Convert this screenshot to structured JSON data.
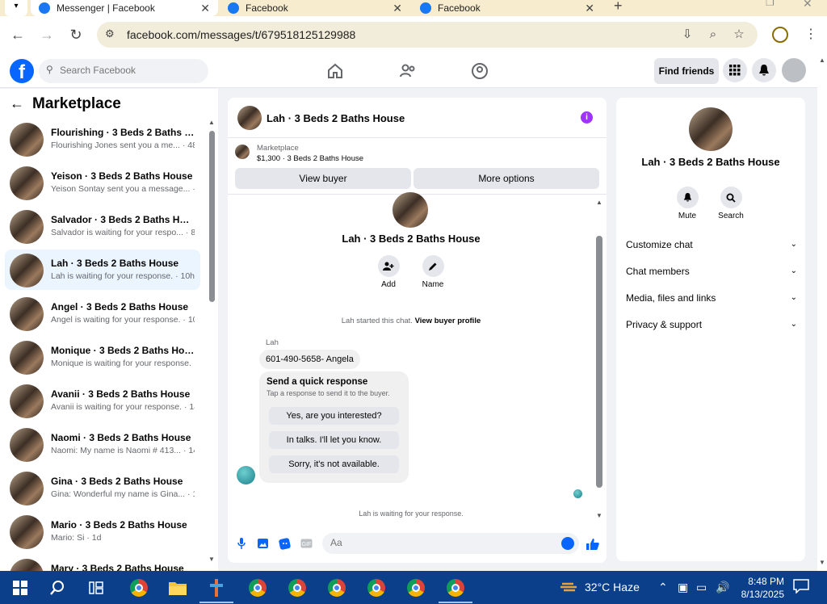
{
  "browser": {
    "tabs": [
      {
        "title": "Messenger | Facebook",
        "active": true
      },
      {
        "title": "Facebook",
        "active": false
      },
      {
        "title": "Facebook",
        "active": false
      }
    ],
    "url": "facebook.com/messages/t/679518125129988"
  },
  "fb_header": {
    "search_placeholder": "Search Facebook",
    "find_friends_label": "Find friends"
  },
  "sidebar": {
    "title": "Marketplace",
    "conversations": [
      {
        "name": "Flourishing · 3 Beds 2 Baths Hou...",
        "preview": "Flourishing Jones sent you a me... · 48m",
        "active": false
      },
      {
        "name": "Yeison · 3 Beds 2 Baths House",
        "preview": "Yeison Sontay sent you a message... · 4h",
        "active": false
      },
      {
        "name": "Salvador · 3 Beds 2 Baths House",
        "preview": "Salvador is waiting for your respo... · 8h",
        "active": false
      },
      {
        "name": "Lah · 3 Beds 2 Baths House",
        "preview": "Lah is waiting for your response. · 10h",
        "active": true
      },
      {
        "name": "Angel · 3 Beds 2 Baths House",
        "preview": "Angel is waiting for your response. · 10h",
        "active": false
      },
      {
        "name": "Monique · 3 Beds 2 Baths House",
        "preview": "Monique is waiting for your response. · 12h",
        "active": false
      },
      {
        "name": "Avanii · 3 Beds 2 Baths House",
        "preview": "Avanii is waiting for your response. · 14h",
        "active": false
      },
      {
        "name": "Naomi · 3 Beds 2 Baths House",
        "preview": "Naomi: My name is Naomi # 413... · 14h",
        "active": false
      },
      {
        "name": "Gina · 3 Beds 2 Baths House",
        "preview": "Gina: Wonderful my name is Gina... · 15h",
        "active": false
      },
      {
        "name": "Mario · 3 Beds 2 Baths House",
        "preview": "Mario: Si · 1d",
        "active": false
      },
      {
        "name": "Mary · 3 Beds 2 Baths House",
        "preview": "",
        "active": false
      }
    ]
  },
  "chat": {
    "title": "Lah · 3 Beds 2 Baths House",
    "marketplace_label": "Marketplace",
    "listing": "$1,300 · 3 Beds 2 Baths House",
    "view_buyer_label": "View buyer",
    "more_options_label": "More options",
    "conversation_name": "Lah · 3 Beds 2 Baths House",
    "add_label": "Add",
    "name_label": "Name",
    "system_message": "Lah started this chat.",
    "view_buyer_profile": "View buyer profile",
    "sender": "Lah",
    "message": "601-490-5658- Angela",
    "quick_response": {
      "title": "Send a quick response",
      "subtitle": "Tap a response to send it to the buyer.",
      "options": [
        "Yes, are you interested?",
        "In talks. I'll let you know.",
        "Sorry, it's not available."
      ]
    },
    "waiting_text": "Lah is waiting for your response.",
    "composer_placeholder": "Aa"
  },
  "right_panel": {
    "name": "Lah · 3 Beds 2 Baths House",
    "mute_label": "Mute",
    "search_label": "Search",
    "sections": [
      "Customize chat",
      "Chat members",
      "Media, files and links",
      "Privacy & support"
    ]
  },
  "taskbar": {
    "weather": "32°C  Haze",
    "time": "8:48 PM",
    "date": "8/13/2025"
  },
  "colors": {
    "fb_blue": "#0866ff",
    "active_conversation_bg": "#ebf5ff",
    "info_purple": "#a033ff",
    "taskbar_bg": "#0b3f8a"
  }
}
